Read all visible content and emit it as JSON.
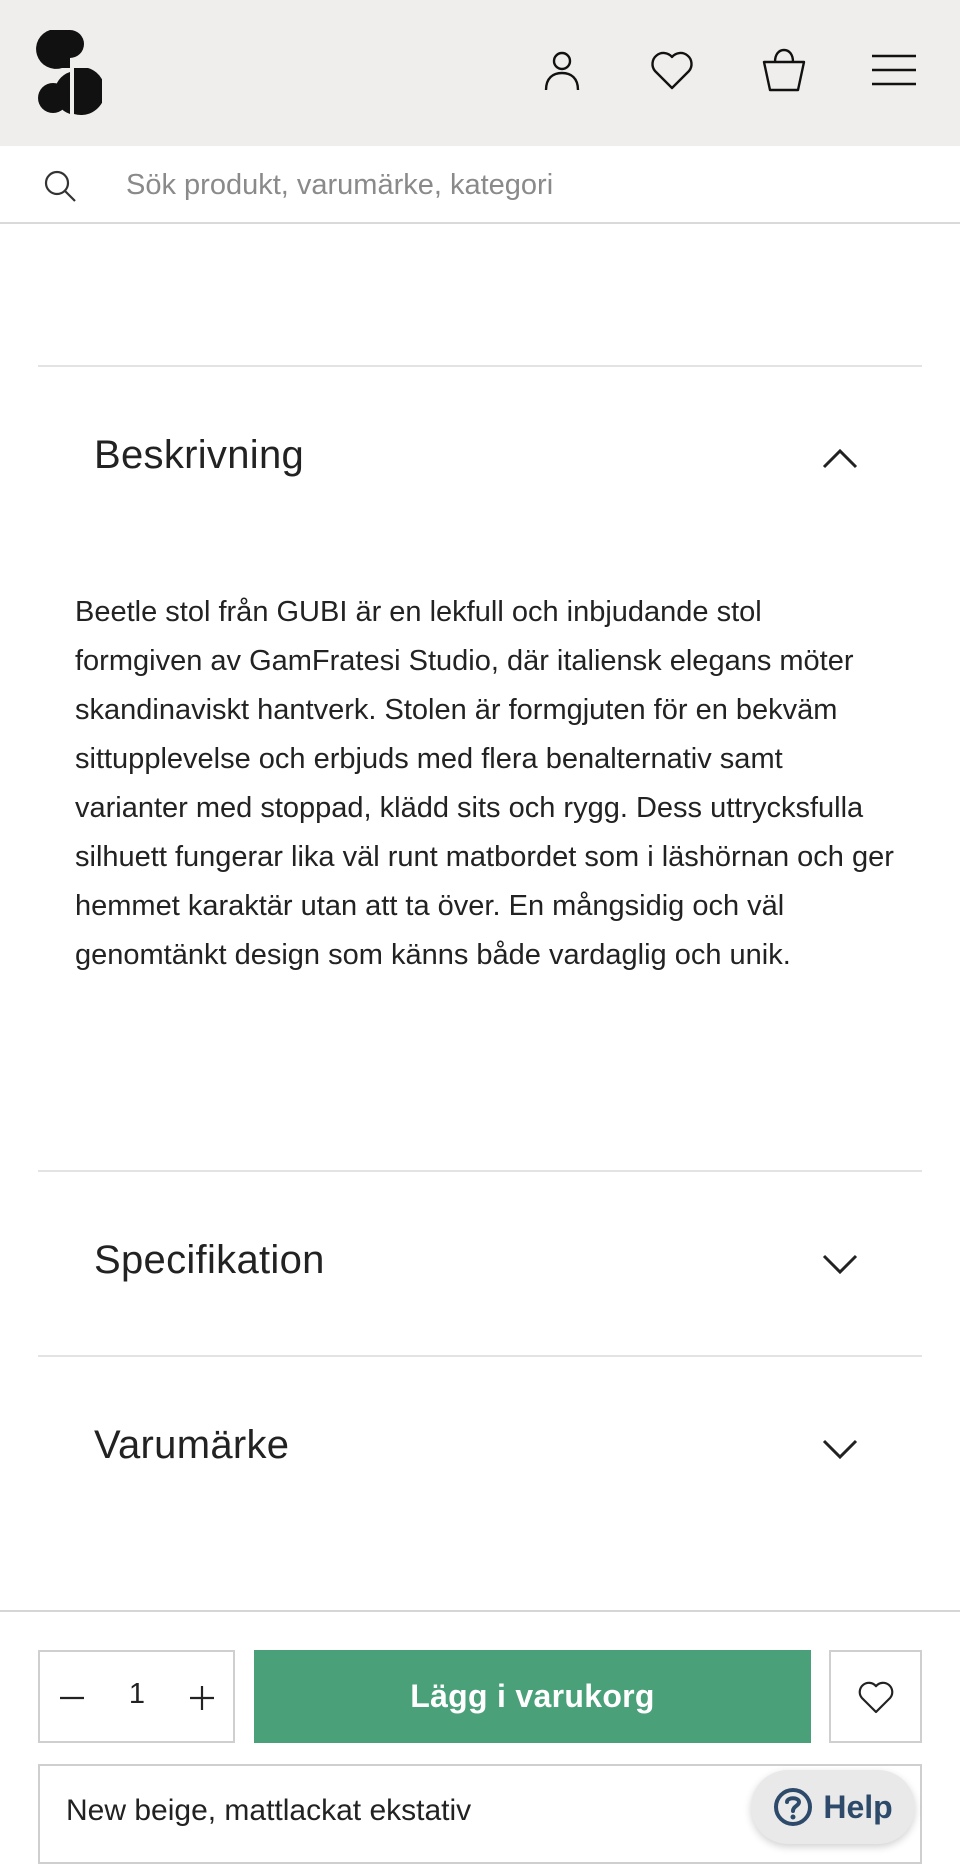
{
  "header": {
    "logo_icon": "s-logo-icon",
    "icons": [
      "user-icon",
      "heart-icon",
      "bag-icon",
      "menu-icon"
    ]
  },
  "search": {
    "placeholder": "Sök produkt, varumärke, kategori",
    "icon": "search-icon"
  },
  "accordion": {
    "description": {
      "title": "Beskrivning",
      "expanded": true,
      "text": "Beetle stol från GUBI är en lekfull och inbjudande stol formgiven av GamFratesi Studio, där italiensk elegans möter skandinaviskt hantverk. Stolen är formgjuten för en bekväm sittupplevelse och erbjuds med flera benalternativ samt varianter med stoppad, klädd sits och rygg. Dess uttrycksfulla silhuett fungerar lika väl runt matbordet som i läshörnan och ger hemmet karaktär utan att ta över. En mångsidig och väl genomtänkt design som känns både vardaglig och unik."
    },
    "specification": {
      "title": "Specifikation",
      "expanded": false
    },
    "brand": {
      "title": "Varumärke",
      "expanded": false
    }
  },
  "purchase": {
    "quantity": "1",
    "add_to_cart_label": "Lägg i varukorg",
    "button_color": "#4aa079",
    "variant_label": "New beige, mattlackat ekstativ"
  },
  "help": {
    "label": "Help",
    "icon": "question-icon"
  }
}
